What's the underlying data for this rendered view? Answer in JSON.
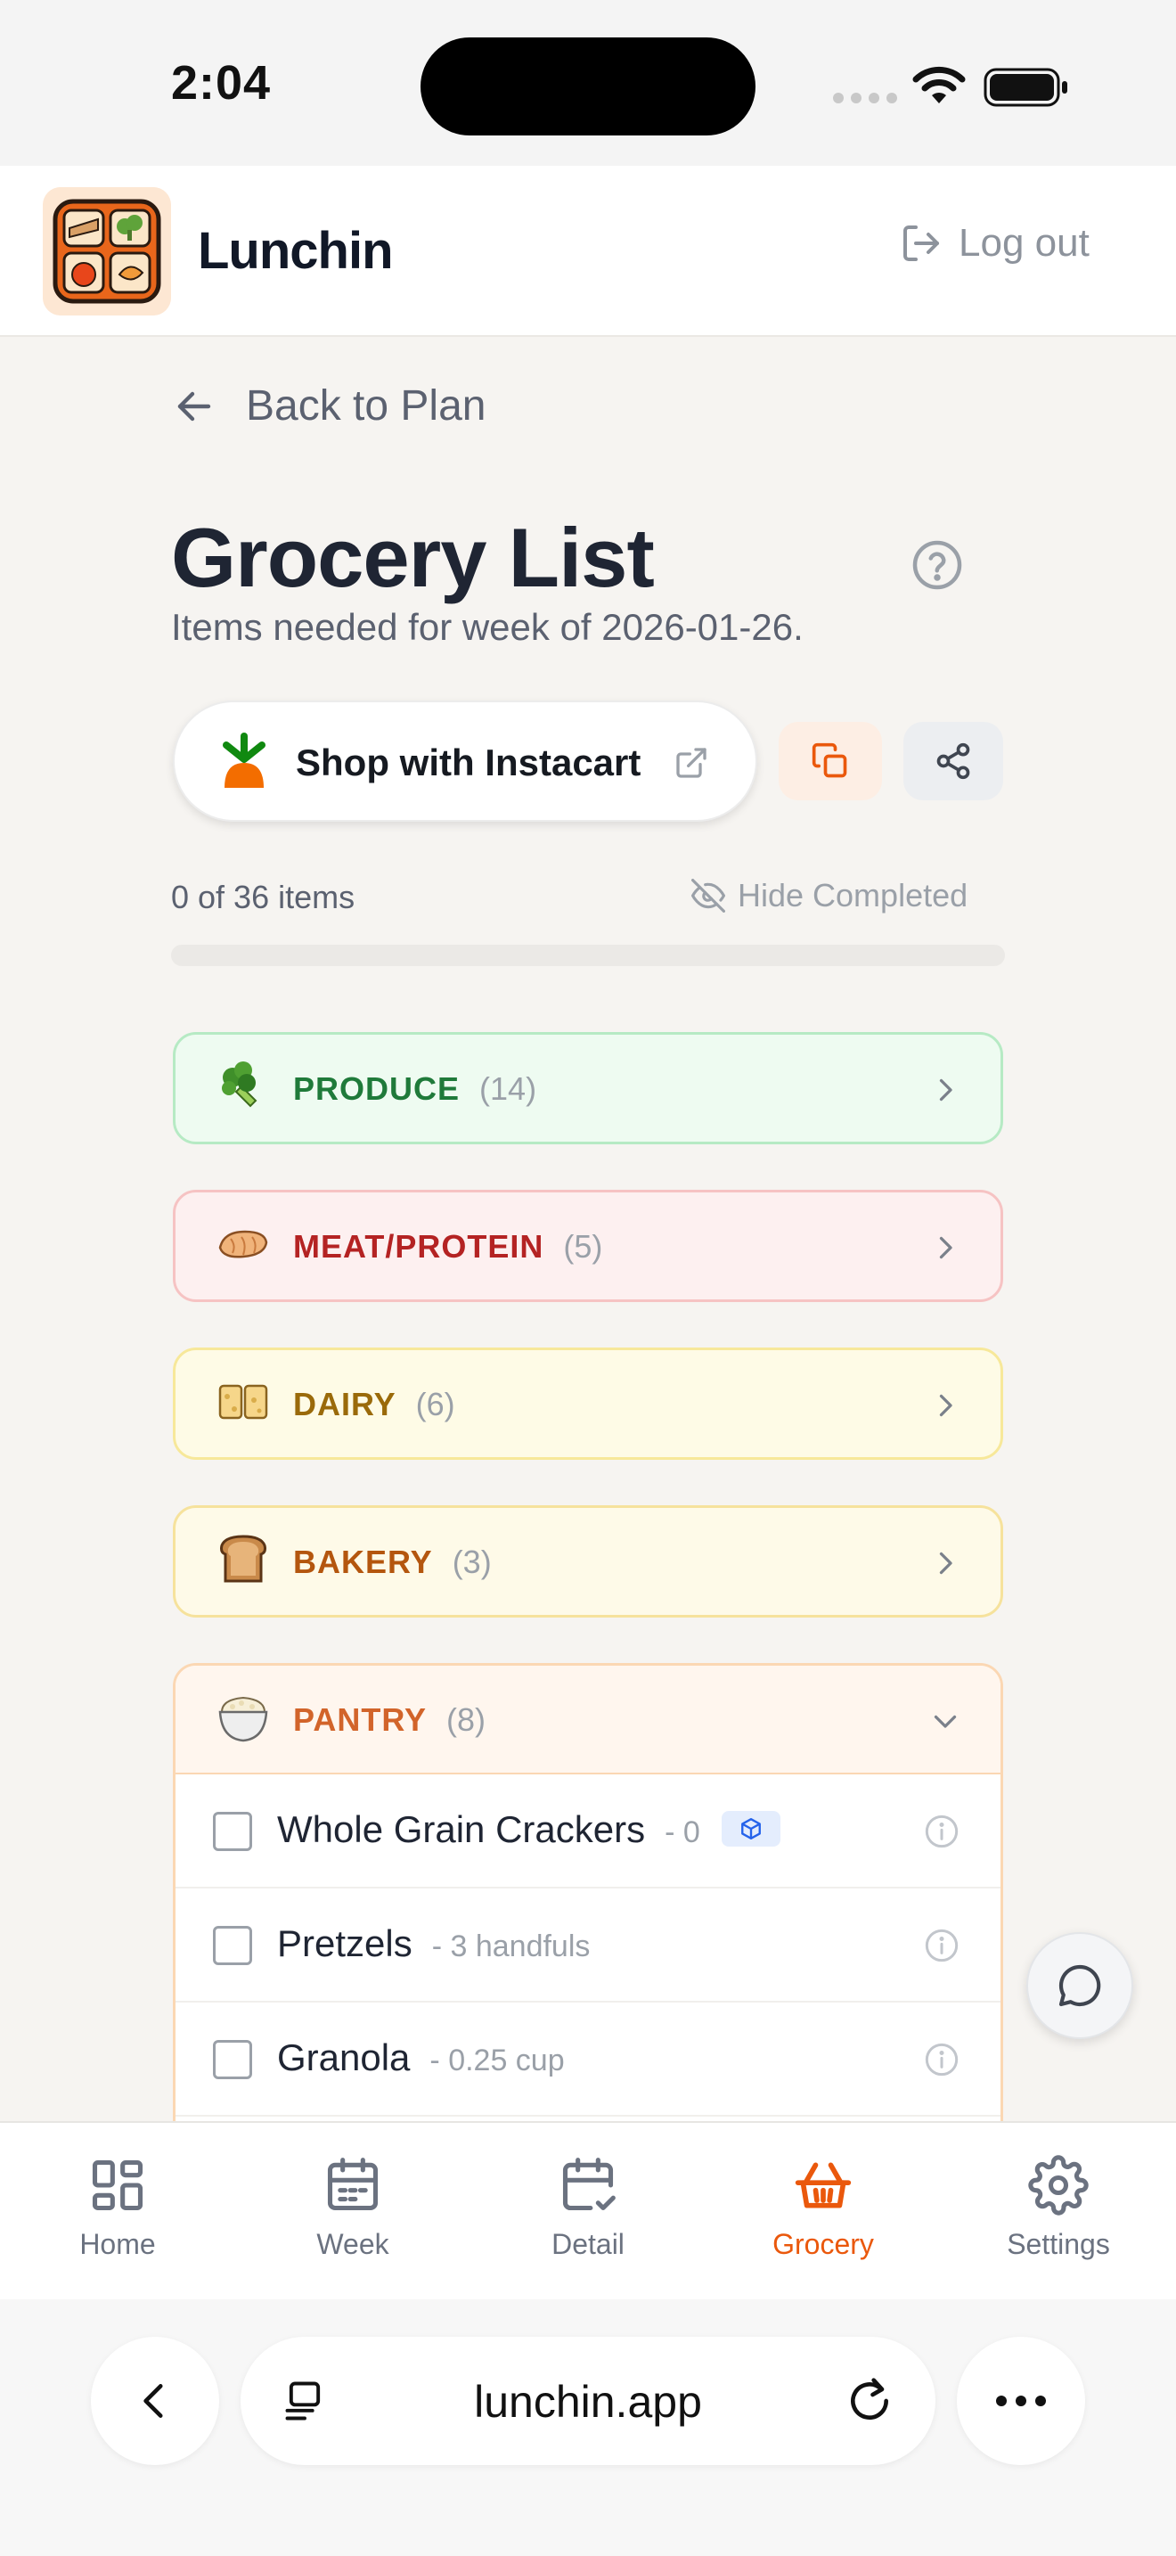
{
  "status_bar": {
    "time": "2:04"
  },
  "header": {
    "app_name": "Lunchin",
    "logout_label": "Log out"
  },
  "nav_back": {
    "label": "Back to Plan"
  },
  "page": {
    "title": "Grocery List",
    "subtitle": "Items needed for week of 2026-01-26."
  },
  "actions": {
    "instacart_label": "Shop with Instacart"
  },
  "progress": {
    "label": "0 of 36 items",
    "completed": 0,
    "total": 36,
    "hide_completed_label": "Hide Completed"
  },
  "categories": [
    {
      "name": "PRODUCE",
      "count": "(14)",
      "icon": "broccoli-icon",
      "expanded": false
    },
    {
      "name": "MEAT/PROTEIN",
      "count": "(5)",
      "icon": "chicken-icon",
      "expanded": false
    },
    {
      "name": "DAIRY",
      "count": "(6)",
      "icon": "cheese-icon",
      "expanded": false
    },
    {
      "name": "BAKERY",
      "count": "(3)",
      "icon": "bread-icon",
      "expanded": false
    },
    {
      "name": "PANTRY",
      "count": "(8)",
      "icon": "rice-bowl-icon",
      "expanded": true,
      "items": [
        {
          "name": "Whole Grain Crackers",
          "qty": "- 0",
          "badge": "package-icon",
          "checked": false
        },
        {
          "name": "Pretzels",
          "qty": "- 3 handfuls",
          "checked": false
        },
        {
          "name": "Granola",
          "qty": "- 0.25 cup",
          "checked": false
        }
      ]
    }
  ],
  "bottom_nav": [
    {
      "label": "Home",
      "icon": "home-grid-icon"
    },
    {
      "label": "Week",
      "icon": "calendar-icon"
    },
    {
      "label": "Detail",
      "icon": "calendar-check-icon"
    },
    {
      "label": "Grocery",
      "icon": "basket-icon",
      "active": true
    },
    {
      "label": "Settings",
      "icon": "gear-icon"
    }
  ],
  "browser": {
    "url": "lunchin.app"
  },
  "colors": {
    "accent": "#ea580c",
    "text": "#1f2533",
    "muted": "#5b6170"
  }
}
